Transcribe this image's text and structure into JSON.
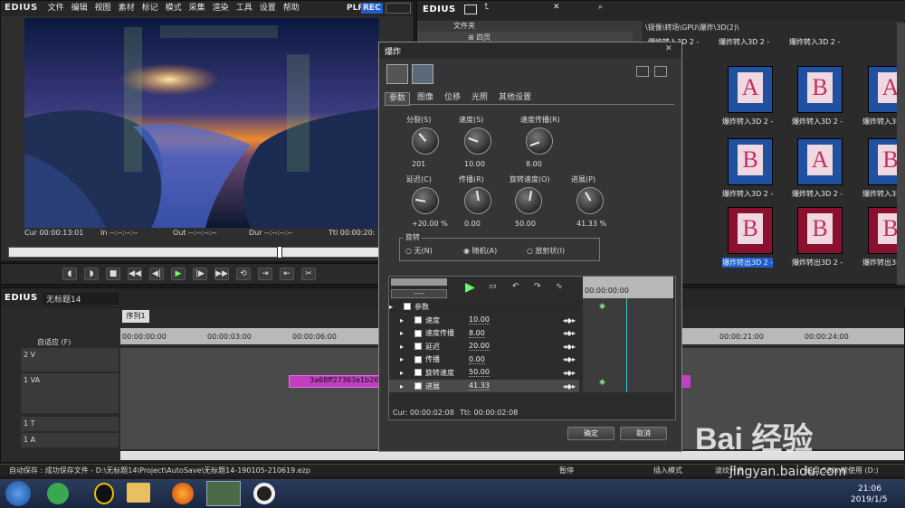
{
  "player": {
    "brand": "EDIUS",
    "menu": [
      "文件",
      "编辑",
      "视图",
      "素材",
      "标记",
      "模式",
      "采集",
      "渲染",
      "工具",
      "设置",
      "帮助"
    ],
    "plr": "PLR",
    "rec": "REC",
    "cur": "Cur 00:00:13:01",
    "in": "In --:--:--:--",
    "out": "Out --:--:--:--",
    "dur": "Dur --:--:--:--",
    "ttl": "Ttl 00:00:20:"
  },
  "bin": {
    "brand": "EDIUS",
    "folder_header": "文件夹",
    "tree_item": "四页",
    "path": "\\镜像\\转场\\GPU\\爆炸\\3D(2)\\",
    "items": [
      {
        "label": "爆炸转入3D 2 -",
        "letter": "A",
        "bg": "#2050a0"
      },
      {
        "label": "爆炸转入3D 2 -",
        "letter": "B",
        "bg": "#2050a0"
      },
      {
        "label": "爆炸转入3D 2 -",
        "letter": "A",
        "bg": "#2050a0"
      },
      {
        "label": "爆炸转入3D 2 -",
        "letter": "B",
        "bg": "#2050a0"
      },
      {
        "label": "爆炸转入3D 2 -",
        "letter": "A",
        "bg": "#2050a0"
      },
      {
        "label": "爆炸转入3D 2 -",
        "letter": "B",
        "bg": "#2050a0"
      },
      {
        "label": "爆炸转出3D 2 -",
        "letter": "B",
        "bg": "#8a1030"
      },
      {
        "label": "爆炸转出3D 2 -",
        "letter": "B",
        "bg": "#8a1030"
      },
      {
        "label": "爆炸转出3D 2 -",
        "letter": "B",
        "bg": "#8a1030"
      }
    ],
    "top_labels": [
      "爆炸转入3D 2 -",
      "爆炸转入3D 2 -",
      "爆炸转入3D 2 -"
    ]
  },
  "timeline": {
    "brand": "EDIUS",
    "project": "无标题14",
    "sequence": "序列1",
    "fit": "自适应 (F)",
    "ruler": [
      "00:00:00:00",
      "00:00:03:00",
      "00:00:06:00",
      "00:00:21:00",
      "00:00:24:00"
    ],
    "tracks": [
      "2 V",
      "1 VA",
      "1 T",
      "1 A"
    ],
    "clip": "3a68ff27363e1b26"
  },
  "dialog": {
    "title": "爆炸",
    "tabs": [
      "参数",
      "图像",
      "位移",
      "光照",
      "其他设置"
    ],
    "knobs": [
      {
        "label": "分裂(S)",
        "value": "201"
      },
      {
        "label": "速度(S)",
        "value": "10.00"
      },
      {
        "label": "速度传播(R)",
        "value": "8.00"
      },
      {
        "label": "延迟(C)",
        "value": "+20.00 %"
      },
      {
        "label": "传播(R)",
        "value": "0.00"
      },
      {
        "label": "旋转速度(O)",
        "value": "50.00"
      },
      {
        "label": "进展(P)",
        "value": "41.33 %"
      }
    ],
    "rotate_label": "旋转",
    "radio": [
      "无(N)",
      "随机(A)",
      "放射状(I)"
    ],
    "kf_root": "参数",
    "kf_rows": [
      {
        "name": "速度",
        "val": "10.00"
      },
      {
        "name": "速度传播",
        "val": "8.00"
      },
      {
        "name": "延迟",
        "val": "20.00"
      },
      {
        "name": "传播",
        "val": "0.00"
      },
      {
        "name": "旋转速度",
        "val": "50.00"
      },
      {
        "name": "进展",
        "val": "41.33"
      }
    ],
    "kf_ruler": "00:00:00:00",
    "dash": "----",
    "cur": "Cur: 00:00:02:08",
    "ttl": "Ttl: 00:00:02:08",
    "ok": "确定",
    "cancel": "取消"
  },
  "status": {
    "autosave": "自动保存 :  成功保存文件 - D:\\无标题14\\Project\\AutoSave\\无标题14-190105-210619.ezp",
    "pause": "暂停",
    "insert": "插入模式",
    "wave": "波纹开启",
    "disk": "磁盘:53% 被使用 (D:)"
  },
  "taskbar": {
    "time": "21:06",
    "date": "2019/1/5"
  },
  "watermark": {
    "brand": "Bai 经验",
    "url": "jingyan.baidu.com"
  }
}
